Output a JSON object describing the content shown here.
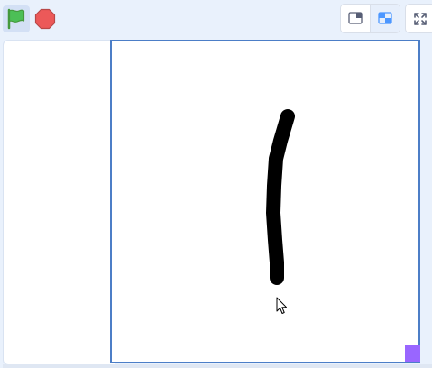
{
  "toolbar": {
    "flag_icon": "green-flag-icon",
    "stop_icon": "stop-sign-icon",
    "small_stage_icon": "small-stage-layout-icon",
    "normal_stage_icon": "normal-stage-layout-icon",
    "fullscreen_icon": "fullscreen-icon"
  },
  "stage": {
    "drawing_color": "#000000",
    "border_color": "#4c7ec7",
    "corner_color": "#9966ff"
  },
  "colors": {
    "flag_green": "#4cbf56",
    "stop_red": "#ec5959",
    "accent_blue": "#4c97ff"
  }
}
